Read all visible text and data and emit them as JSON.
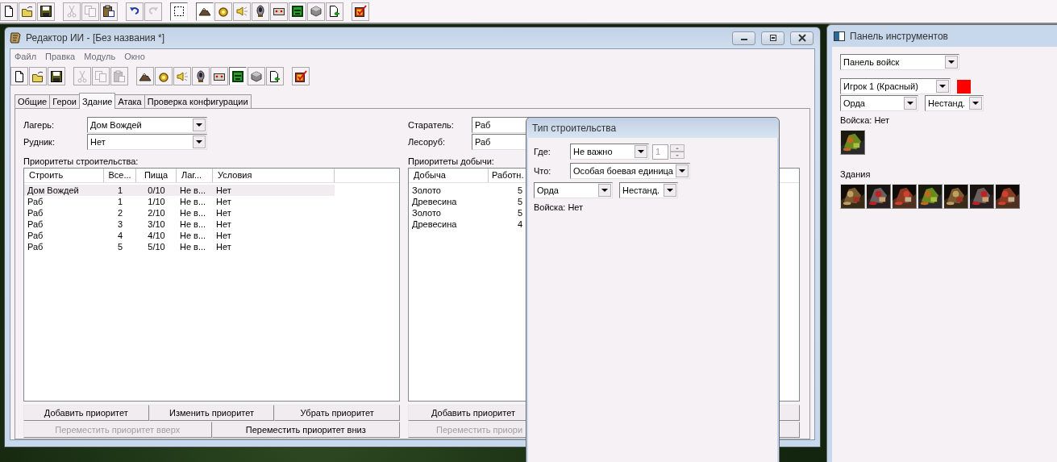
{
  "main_toolbar": [
    {
      "kind": "new",
      "disabled": false,
      "pressed": false
    },
    {
      "kind": "open",
      "disabled": false,
      "pressed": false
    },
    {
      "kind": "save",
      "disabled": false,
      "pressed": false
    },
    {
      "kind": "separator"
    },
    {
      "kind": "cut",
      "disabled": true,
      "pressed": false
    },
    {
      "kind": "copy",
      "disabled": true,
      "pressed": false
    },
    {
      "kind": "paste",
      "disabled": false,
      "pressed": false
    },
    {
      "kind": "separator"
    },
    {
      "kind": "undo",
      "disabled": false,
      "pressed": false
    },
    {
      "kind": "redo",
      "disabled": true,
      "pressed": false
    },
    {
      "kind": "separator"
    },
    {
      "kind": "select",
      "disabled": false,
      "pressed": true
    },
    {
      "kind": "separator"
    },
    {
      "kind": "terrain",
      "disabled": false,
      "pressed": true
    },
    {
      "kind": "gold",
      "disabled": false,
      "pressed": false
    },
    {
      "kind": "sound",
      "disabled": false,
      "pressed": false
    },
    {
      "kind": "figure",
      "disabled": false,
      "pressed": false
    },
    {
      "kind": "chest",
      "disabled": false,
      "pressed": false
    },
    {
      "kind": "mask",
      "disabled": false,
      "pressed": false
    },
    {
      "kind": "cube",
      "disabled": false,
      "pressed": false
    },
    {
      "kind": "page",
      "disabled": false,
      "pressed": false
    },
    {
      "kind": "separator"
    },
    {
      "kind": "check",
      "disabled": false,
      "pressed": false
    }
  ],
  "editor": {
    "title": "Редактор ИИ - [Без названия *]",
    "menu": [
      "Файл",
      "Правка",
      "Модуль",
      "Окно"
    ],
    "toolbar": [
      {
        "kind": "new",
        "disabled": false,
        "pressed": false
      },
      {
        "kind": "open",
        "disabled": false,
        "pressed": false
      },
      {
        "kind": "save",
        "disabled": false,
        "pressed": false
      },
      {
        "kind": "separator"
      },
      {
        "kind": "cut",
        "disabled": true,
        "pressed": false
      },
      {
        "kind": "copy",
        "disabled": true,
        "pressed": false
      },
      {
        "kind": "paste",
        "disabled": true,
        "pressed": false
      },
      {
        "kind": "separator"
      },
      {
        "kind": "terrain",
        "disabled": false,
        "pressed": false
      },
      {
        "kind": "gold",
        "disabled": false,
        "pressed": false
      },
      {
        "kind": "sound",
        "disabled": false,
        "pressed": false
      },
      {
        "kind": "figure",
        "disabled": false,
        "pressed": false
      },
      {
        "kind": "chest",
        "disabled": false,
        "pressed": false
      },
      {
        "kind": "mask",
        "disabled": false,
        "pressed": true
      },
      {
        "kind": "cube",
        "disabled": false,
        "pressed": false
      },
      {
        "kind": "page",
        "disabled": false,
        "pressed": false
      },
      {
        "kind": "separator"
      },
      {
        "kind": "check",
        "disabled": false,
        "pressed": false
      }
    ],
    "tabs": [
      {
        "label": "Общие",
        "selected": false
      },
      {
        "label": "Герои",
        "selected": false
      },
      {
        "label": "Здание",
        "selected": true
      },
      {
        "label": "Атака",
        "selected": false
      },
      {
        "label": "Проверка конфигурации",
        "selected": false
      }
    ],
    "camp": {
      "label": "Лагерь:",
      "value": "Дом Вождей"
    },
    "mine": {
      "label": "Рудник:",
      "value": "Нет"
    },
    "build_priorities": {
      "label": "Приоритеты строительства:",
      "columns": [
        "Строить",
        "Все...",
        "Пища",
        "Лаг...",
        "Условия"
      ],
      "rows": [
        {
          "cells": [
            "Дом Вождей",
            "1",
            "0/10",
            "Не в...",
            "Нет"
          ],
          "selected": true
        },
        {
          "cells": [
            "Раб",
            "1",
            "1/10",
            "Не в...",
            "Нет"
          ],
          "selected": false
        },
        {
          "cells": [
            "Раб",
            "2",
            "2/10",
            "Не в...",
            "Нет"
          ],
          "selected": false
        },
        {
          "cells": [
            "Раб",
            "3",
            "3/10",
            "Не в...",
            "Нет"
          ],
          "selected": false
        },
        {
          "cells": [
            "Раб",
            "4",
            "4/10",
            "Не в...",
            "Нет"
          ],
          "selected": false
        },
        {
          "cells": [
            "Раб",
            "5",
            "5/10",
            "Не в...",
            "Нет"
          ],
          "selected": false
        }
      ]
    },
    "build_buttons": [
      {
        "label": "Добавить приоритет",
        "disabled": false
      },
      {
        "label": "Изменить приоритет",
        "disabled": false
      },
      {
        "label": "Убрать приоритет",
        "disabled": false
      }
    ],
    "build_move_buttons": [
      {
        "label": "Переместить приоритет вверх",
        "disabled": true
      },
      {
        "label": "Переместить приоритет вниз",
        "disabled": false
      }
    ],
    "prospector": {
      "label": "Старатель:",
      "value": "Раб"
    },
    "lumberjack": {
      "label": "Лесоруб:",
      "value": "Раб"
    },
    "harvest_priorities": {
      "label": "Приоритеты добычи:",
      "columns": [
        "Добыча",
        "Работн."
      ],
      "rows": [
        {
          "cells": [
            "Золото",
            "5"
          ],
          "selected": false
        },
        {
          "cells": [
            "Древесина",
            "5"
          ],
          "selected": false
        },
        {
          "cells": [
            "Золото",
            "5"
          ],
          "selected": false
        },
        {
          "cells": [
            "Древесина",
            "4"
          ],
          "selected": false
        }
      ]
    },
    "harvest_add_button": {
      "label": "Добавить приоритет",
      "disabled": false
    },
    "harvest_move_button": {
      "label": "Переместить приори",
      "disabled": true
    }
  },
  "dialog": {
    "title": "Тип строительства",
    "where": {
      "label": "Где:",
      "value": "Не важно",
      "spin_value": "1",
      "spin_disabled": true
    },
    "what": {
      "label": "Что:",
      "value": "Особая боевая единица"
    },
    "race": "Орда",
    "variant": "Нестанд.",
    "troops": "Войска: Нет"
  },
  "tools": {
    "title": "Панель инструментов",
    "panel": "Панель войск",
    "player": "Игрок 1 (Красный)",
    "race": "Орда",
    "variant": "Нестанд.",
    "troops_label": "Войска: Нет",
    "buildings_label": "Здания"
  }
}
